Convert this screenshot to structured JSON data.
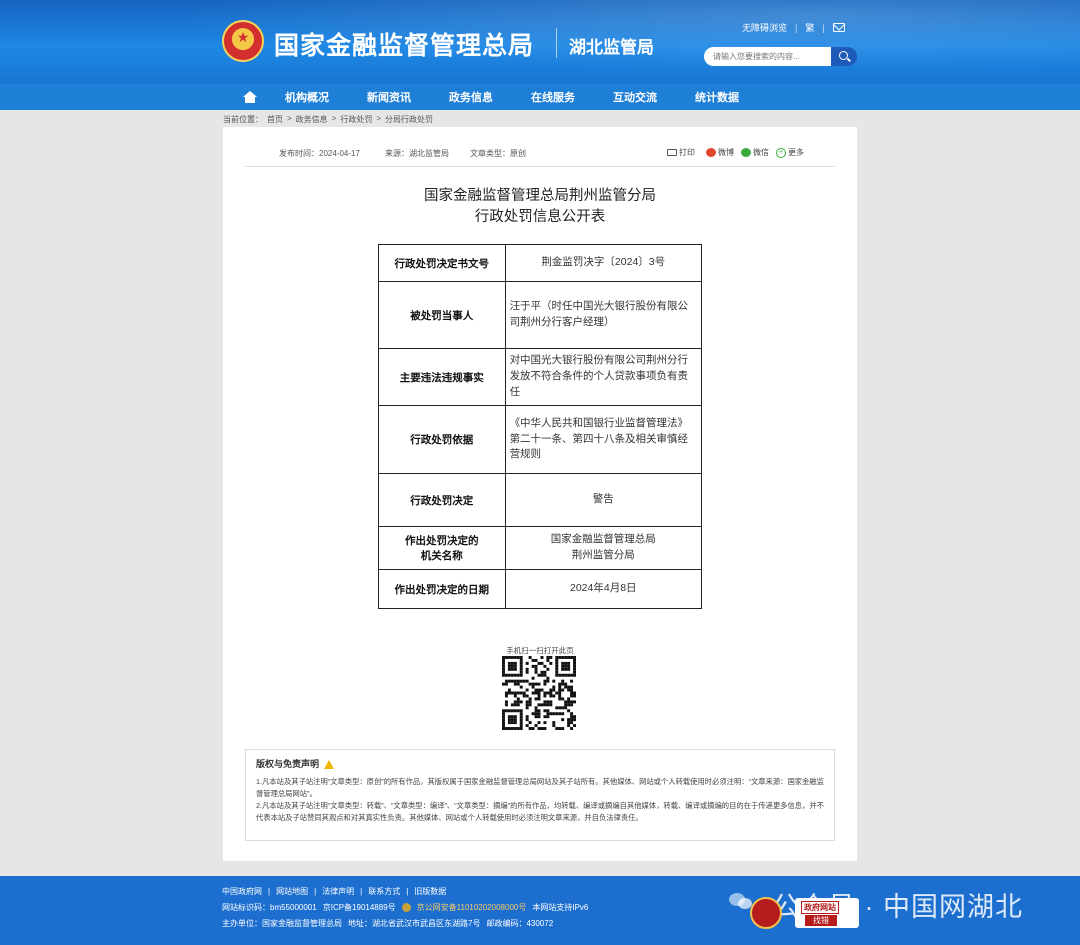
{
  "header": {
    "site_title": "国家金融监督管理总局",
    "site_sub": "湖北监管局",
    "accessibility": "无障碍浏览",
    "language": "繁",
    "search_placeholder": "请输入您要搜索的内容..."
  },
  "nav": {
    "items": [
      "机构概况",
      "新闻资讯",
      "政务信息",
      "在线服务",
      "互动交流",
      "统计数据"
    ]
  },
  "breadcrumb": {
    "label": "当前位置：",
    "items": [
      "首页",
      "政务信息",
      "行政处罚",
      "分局行政处罚"
    ],
    "sep": ">"
  },
  "meta": {
    "publish_time": "发布时间：2024-04-17",
    "source": "来源：湖北监管局",
    "type": "文章类型：原创",
    "print": "打印",
    "weibo": "微博",
    "wechat": "微信",
    "more": "更多"
  },
  "document": {
    "title_line1": "国家金融监督管理总局荆州监管分局",
    "title_line2": "行政处罚信息公开表",
    "rows": [
      {
        "key": "行政处罚决定书文号",
        "value": "荆金监罚决字〔2024〕3号"
      },
      {
        "key": "被处罚当事人",
        "value": "汪于平（时任中国光大银行股份有限公司荆州分行客户经理）"
      },
      {
        "key": "主要违法违规事实",
        "value": "对中国光大银行股份有限公司荆州分行发放不符合条件的个人贷款事项负有责任"
      },
      {
        "key": "行政处罚依据",
        "value": "《中华人民共和国银行业监督管理法》第二十一条、第四十八条及相关审慎经营规则"
      },
      {
        "key": "行政处罚决定",
        "value": "警告"
      },
      {
        "key": "作出处罚决定的机关名称",
        "key_line1": "作出处罚决定的",
        "key_line2": "机关名称",
        "value_line1": "国家金融监督管理总局",
        "value_line2": "荆州监管分局"
      },
      {
        "key": "作出处罚决定的日期",
        "value": "2024年4月8日"
      }
    ]
  },
  "qr": {
    "label": "手机扫一扫打开此页"
  },
  "disclaimer": {
    "title": "版权与免责声明",
    "p1": "1.凡本站及其子站注明“文章类型：原创”的所有作品，其版权属于国家金融监督管理总局网站及其子站所有。其他媒体、网站或个人转载使用时必须注明：“文章来源：国家金融监督管理总局网站”。",
    "p2": "2.凡本站及其子站注明“文章类型：转载”、“文章类型：编译”、“文章类型：摘编”的所有作品，均转载、编译或摘编自其他媒体，转载、编译或摘编的目的在于传递更多信息，并不代表本站及子站赞同其观点和对其真实性负责。其他媒体、网站或个人转载使用时必须注明文章来源，并自负法律责任。"
  },
  "footer": {
    "links": [
      "中国政府网",
      "网站地图",
      "法律声明",
      "联系方式",
      "旧版数据"
    ],
    "site_code": "网站标识码：bm55000001",
    "icp": "京ICP备19014889号",
    "police": "京公网安备11010202008000号",
    "ipv6": "本网站支持IPv6",
    "host": "主办单位：国家金融监督管理总局",
    "address": "地址：湖北省武汉市武昌区东湖路7号",
    "postcode": "邮政编码：430072",
    "watermark": "公众号 · 中国网湖北",
    "badge_top": "政府网站",
    "badge_bottom": "找错"
  }
}
